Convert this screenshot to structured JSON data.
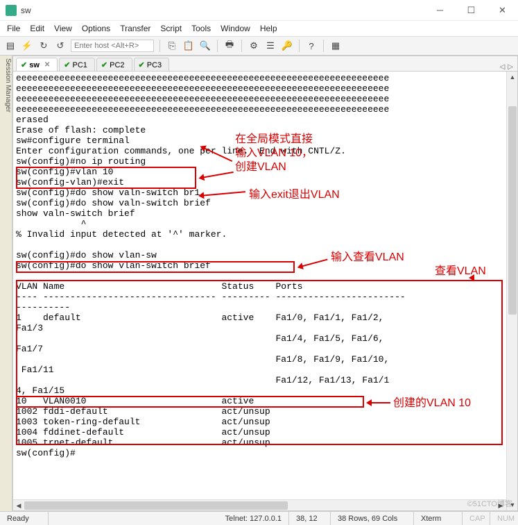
{
  "window": {
    "title": "sw"
  },
  "menu": [
    "File",
    "Edit",
    "View",
    "Options",
    "Transfer",
    "Script",
    "Tools",
    "Window",
    "Help"
  ],
  "toolbar": {
    "host_placeholder": "Enter host <Alt+R>"
  },
  "sidebar": {
    "label": "Session Manager"
  },
  "tabs": [
    {
      "label": "sw",
      "active": true,
      "closable": true
    },
    {
      "label": "PC1",
      "active": false,
      "closable": false
    },
    {
      "label": "PC2",
      "active": false,
      "closable": false
    },
    {
      "label": "PC3",
      "active": false,
      "closable": false
    }
  ],
  "terminal_lines": [
    "eeeeeeeeeeeeeeeeeeeeeeeeeeeeeeeeeeeeeeeeeeeeeeeeeeeeeeeeeeeeeeeeeeeee",
    "eeeeeeeeeeeeeeeeeeeeeeeeeeeeeeeeeeeeeeeeeeeeeeeeeeeeeeeeeeeeeeeeeeeee",
    "eeeeeeeeeeeeeeeeeeeeeeeeeeeeeeeeeeeeeeeeeeeeeeeeeeeeeeeeeeeeeeeeeeeee",
    "eeeeeeeeeeeeeeeeeeeeeeeeeeeeeeeeeeeeeeeeeeeeeeeeeeeeeeeeeeeeeeeeeeeee",
    "erased",
    "Erase of flash: complete",
    "sw#configure terminal",
    "Enter configuration commands, one per line.  End with CNTL/Z.",
    "sw(config)#no ip routing",
    "sw(config)#vlan 10",
    "sw(config-vlan)#exit",
    "sw(config)#do show valn-switch br1",
    "sw(config)#do show valn-switch brief",
    "show valn-switch brief",
    "            ^",
    "% Invalid input detected at '^' marker.",
    "",
    "sw(config)#do show vlan-sw",
    "sw(config)#do show vlan-switch brief",
    "",
    "VLAN Name                             Status    Ports",
    "---- -------------------------------- --------- ------------------------",
    "----------",
    "1    default                          active    Fa1/0, Fa1/1, Fa1/2,",
    "Fa1/3",
    "                                                Fa1/4, Fa1/5, Fa1/6,",
    "Fa1/7",
    "                                                Fa1/8, Fa1/9, Fa1/10,",
    " Fa1/11",
    "                                                Fa1/12, Fa1/13, Fa1/1",
    "4, Fa1/15",
    "10   VLAN0010                         active",
    "1002 fddi-default                     act/unsup",
    "1003 token-ring-default               act/unsup",
    "1004 fddinet-default                  act/unsup",
    "1005 trnet-default                    act/unsup",
    "sw(config)#"
  ],
  "annotations": {
    "a1_lines": [
      "在全局模式直接",
      "输入VLAN 10，",
      "创建VLAN"
    ],
    "a2": "输入exit退出VLAN",
    "a3": "输入查看VLAN",
    "a4": "查看VLAN",
    "a5": "创建的VLAN 10"
  },
  "status": {
    "ready": "Ready",
    "telnet": "Telnet: 127.0.0.1",
    "cursor": "38, 12",
    "size": "38 Rows, 69 Cols",
    "term": "Xterm",
    "caps": "CAP",
    "num": "NUM"
  },
  "watermark": "©51CTO博客"
}
